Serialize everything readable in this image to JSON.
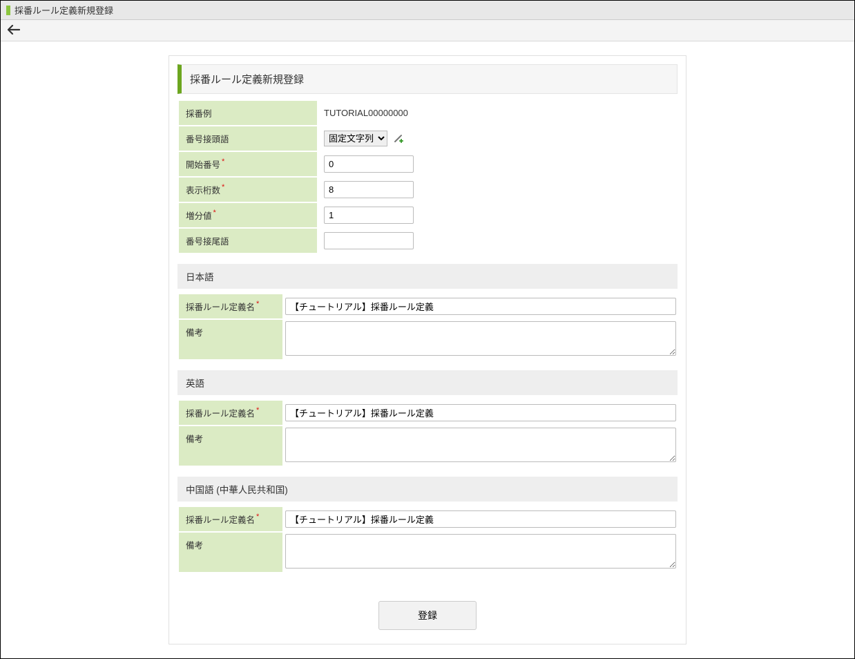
{
  "header": {
    "title": "採番ルール定義新規登録"
  },
  "card": {
    "title": "採番ルール定義新規登録"
  },
  "fields": {
    "sample_label": "採番例",
    "sample_value": "TUTORIAL00000000",
    "prefix_label": "番号接頭語",
    "prefix_select_value": "固定文字列",
    "start_label": "開始番号",
    "start_value": "0",
    "digits_label": "表示桁数",
    "digits_value": "8",
    "increment_label": "増分値",
    "increment_value": "1",
    "suffix_label": "番号接尾語",
    "suffix_value": ""
  },
  "langs": {
    "ja": {
      "header": "日本語",
      "name_label": "採番ルール定義名",
      "name_value": "【チュートリアル】採番ルール定義",
      "remark_label": "備考",
      "remark_value": ""
    },
    "en": {
      "header": "英語",
      "name_label": "採番ルール定義名",
      "name_value": "【チュートリアル】採番ルール定義",
      "remark_label": "備考",
      "remark_value": ""
    },
    "zh": {
      "header": "中国語 (中華人民共和国)",
      "name_label": "採番ルール定義名",
      "name_value": "【チュートリアル】採番ルール定義",
      "remark_label": "備考",
      "remark_value": ""
    }
  },
  "actions": {
    "register_label": "登録"
  },
  "required_mark": "*"
}
